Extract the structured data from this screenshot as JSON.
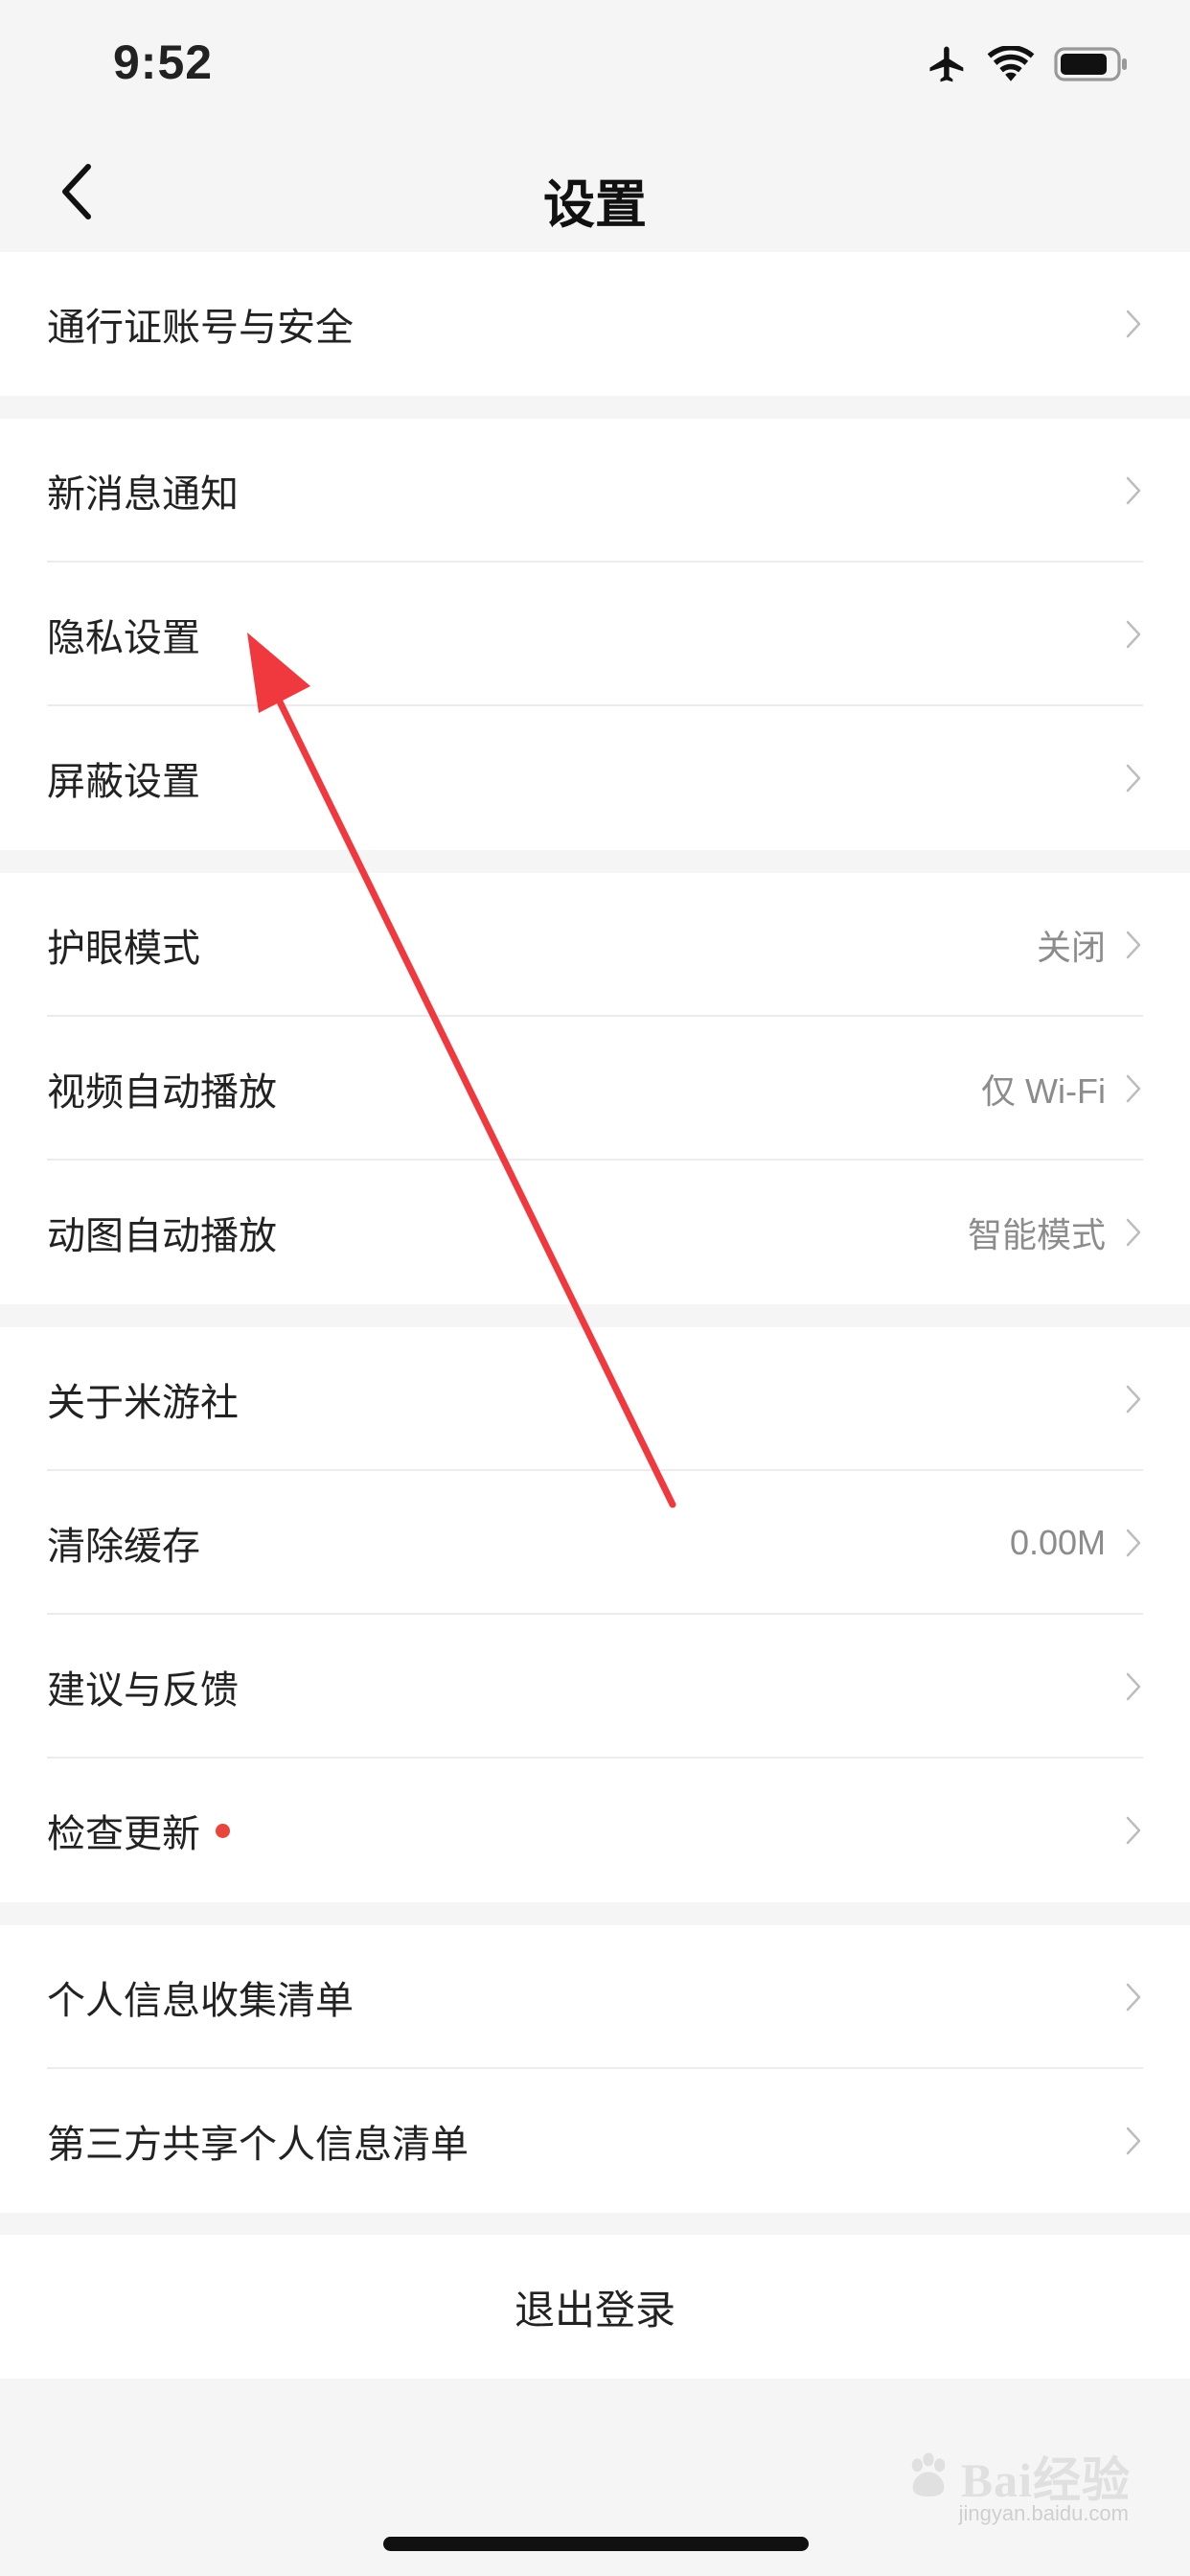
{
  "status_bar": {
    "time": "9:52",
    "icons": [
      "airplane-icon",
      "wifi-icon",
      "battery-icon"
    ]
  },
  "nav": {
    "title": "设置",
    "back_icon": "chevron-left-icon"
  },
  "groups": [
    {
      "items": [
        {
          "label": "通行证账号与安全",
          "value": ""
        }
      ]
    },
    {
      "items": [
        {
          "label": "新消息通知",
          "value": ""
        },
        {
          "label": "隐私设置",
          "value": ""
        },
        {
          "label": "屏蔽设置",
          "value": ""
        }
      ]
    },
    {
      "items": [
        {
          "label": "护眼模式",
          "value": "关闭"
        },
        {
          "label": "视频自动播放",
          "value": "仅 Wi-Fi"
        },
        {
          "label": "动图自动播放",
          "value": "智能模式"
        }
      ]
    },
    {
      "items": [
        {
          "label": "关于米游社",
          "value": ""
        },
        {
          "label": "清除缓存",
          "value": "0.00M"
        },
        {
          "label": "建议与反馈",
          "value": ""
        },
        {
          "label": "检查更新",
          "value": "",
          "badge": "red-dot"
        }
      ]
    },
    {
      "items": [
        {
          "label": "个人信息收集清单",
          "value": ""
        },
        {
          "label": "第三方共享个人信息清单",
          "value": ""
        }
      ]
    }
  ],
  "logout": {
    "label": "退出登录"
  },
  "colors": {
    "background": "#f5f5f5",
    "card": "#ffffff",
    "secondary_text": "#8c8c8c",
    "badge_red": "#e8453c",
    "annotation_arrow": "#f0393f"
  },
  "watermark": {
    "text": "Bai经验",
    "sub": "jingyan.baidu.com"
  }
}
